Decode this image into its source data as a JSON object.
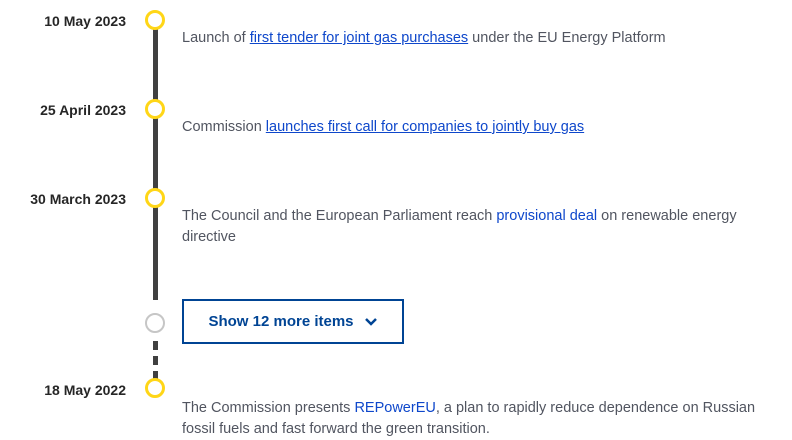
{
  "timeline": {
    "items": [
      {
        "date": "10 May 2023",
        "pre": "Launch of ",
        "link": "first tender for joint gas purchases",
        "post": " under the EU Energy Platform"
      },
      {
        "date": "25 April 2023",
        "pre": "Commission ",
        "link": "launches first call for companies to jointly buy gas",
        "post": ""
      },
      {
        "date": "30 March 2023",
        "pre": "The Council and the European Parliament reach ",
        "link": "provisional deal",
        "post": " on renewable energy directive"
      },
      {
        "date": "18 May 2022",
        "pre": "The Commission presents ",
        "link": "REPowerEU",
        "post": ", a plan to rapidly reduce dependence on Russian fossil fuels and fast forward the green transition."
      }
    ],
    "show_more_label": "Show 12 more items",
    "show_more_icon": "chevron-down-icon",
    "colors": {
      "accent": "#ffd617",
      "link": "#0e47cb",
      "button": "#004494",
      "line": "#404040"
    }
  }
}
